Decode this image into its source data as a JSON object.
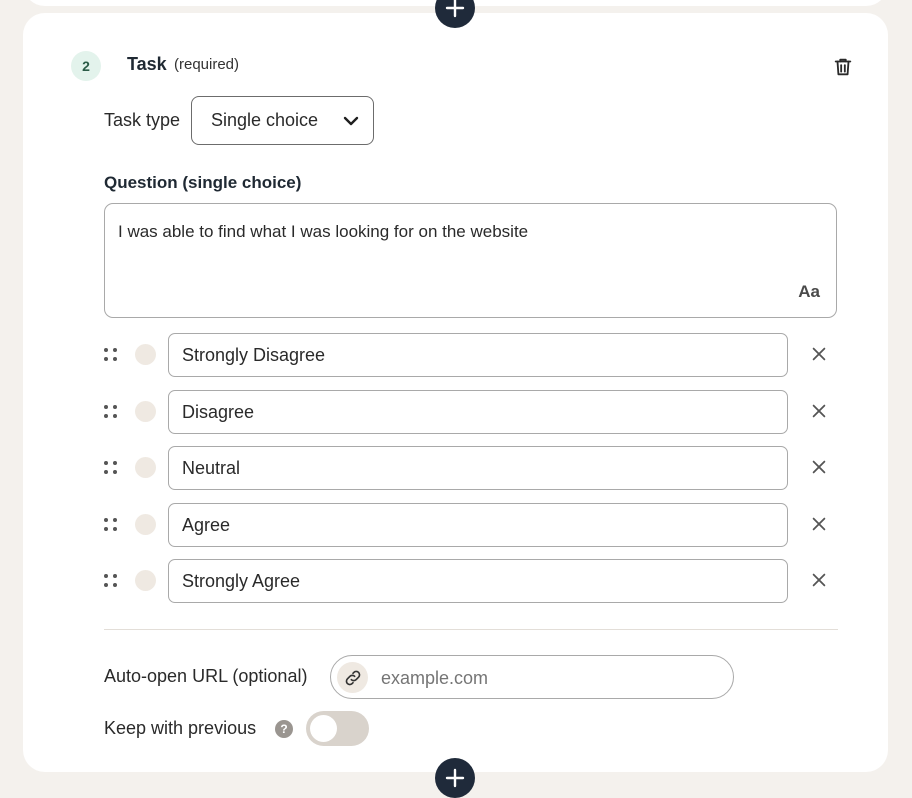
{
  "task": {
    "step_number": "2",
    "title": "Task",
    "required_label": "(required)",
    "type_label": "Task type",
    "type_value": "Single choice",
    "question_label": "Question (single choice)",
    "question_text": "I was able to find what I was looking for on the website",
    "format_button": "Aa",
    "options": [
      {
        "label": "Strongly Disagree"
      },
      {
        "label": "Disagree"
      },
      {
        "label": "Neutral"
      },
      {
        "label": "Agree"
      },
      {
        "label": "Strongly Agree"
      }
    ],
    "auto_open": {
      "label": "Auto-open URL (optional)",
      "placeholder": "example.com"
    },
    "keep_with_previous": {
      "label": "Keep with previous",
      "help": "?",
      "enabled": false
    }
  },
  "icons": {
    "add": "plus-icon",
    "delete": "trash-icon",
    "chevron": "chevron-down-icon",
    "drag": "drag-handle-icon",
    "remove": "close-icon",
    "link": "link-icon"
  },
  "colors": {
    "page_bg": "#f4f1ed",
    "card_bg": "#ffffff",
    "accent_dark": "#1f2a3a",
    "badge_bg": "#e3f3ec",
    "badge_text": "#2b5c47",
    "radio_bg": "#efe9e2",
    "toggle_off": "#d9d3cc"
  }
}
